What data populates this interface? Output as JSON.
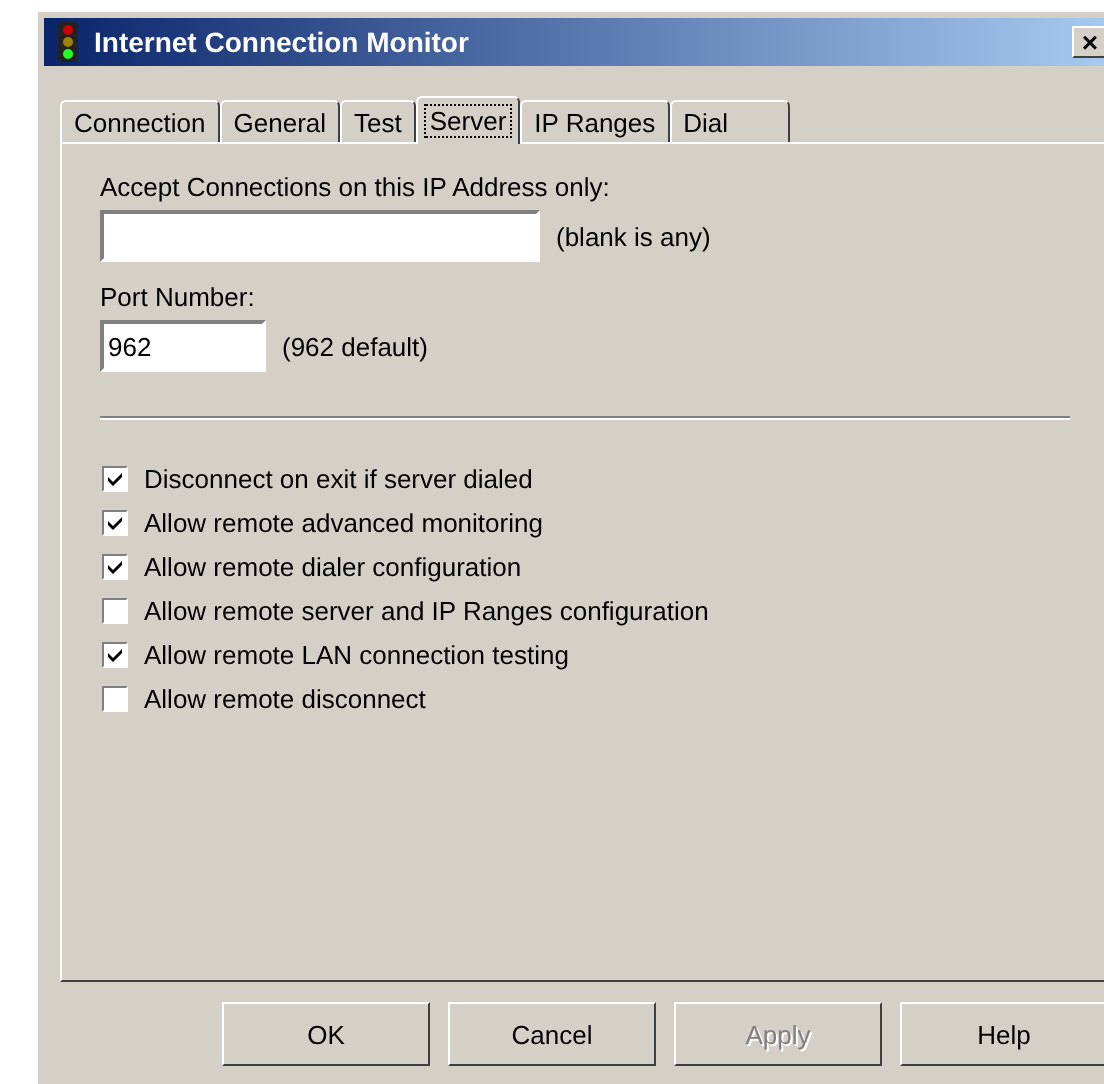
{
  "window": {
    "title": "Internet Connection Monitor",
    "close": "×"
  },
  "tabs": [
    {
      "label": "Connection",
      "selected": false
    },
    {
      "label": "General",
      "selected": false
    },
    {
      "label": "Test",
      "selected": false
    },
    {
      "label": "Server",
      "selected": true
    },
    {
      "label": "IP Ranges",
      "selected": false
    },
    {
      "label": "Dial",
      "selected": false
    }
  ],
  "fields": [
    {
      "label": "Accept Connections on this IP Address only:",
      "hint": "(blank is any)"
    },
    {
      "label": "Port Number:",
      "value": "962",
      "hint": "(962 default)"
    }
  ],
  "options": [
    {
      "label": "Disconnect on exit if server dialed",
      "checked": true
    },
    {
      "label": "Allow remote advanced monitoring",
      "checked": true
    },
    {
      "label": "Allow remote dialer configuration",
      "checked": true
    },
    {
      "label": "Allow remote server and IP Ranges configuration",
      "checked": false
    },
    {
      "label": "Allow remote LAN connection testing",
      "checked": true
    },
    {
      "label": "Allow remote disconnect",
      "checked": false
    }
  ],
  "buttons": [
    {
      "label": "OK",
      "disabled": false
    },
    {
      "label": "Cancel",
      "disabled": false
    },
    {
      "label": "Apply",
      "disabled": true
    },
    {
      "label": "Help",
      "disabled": false
    }
  ]
}
